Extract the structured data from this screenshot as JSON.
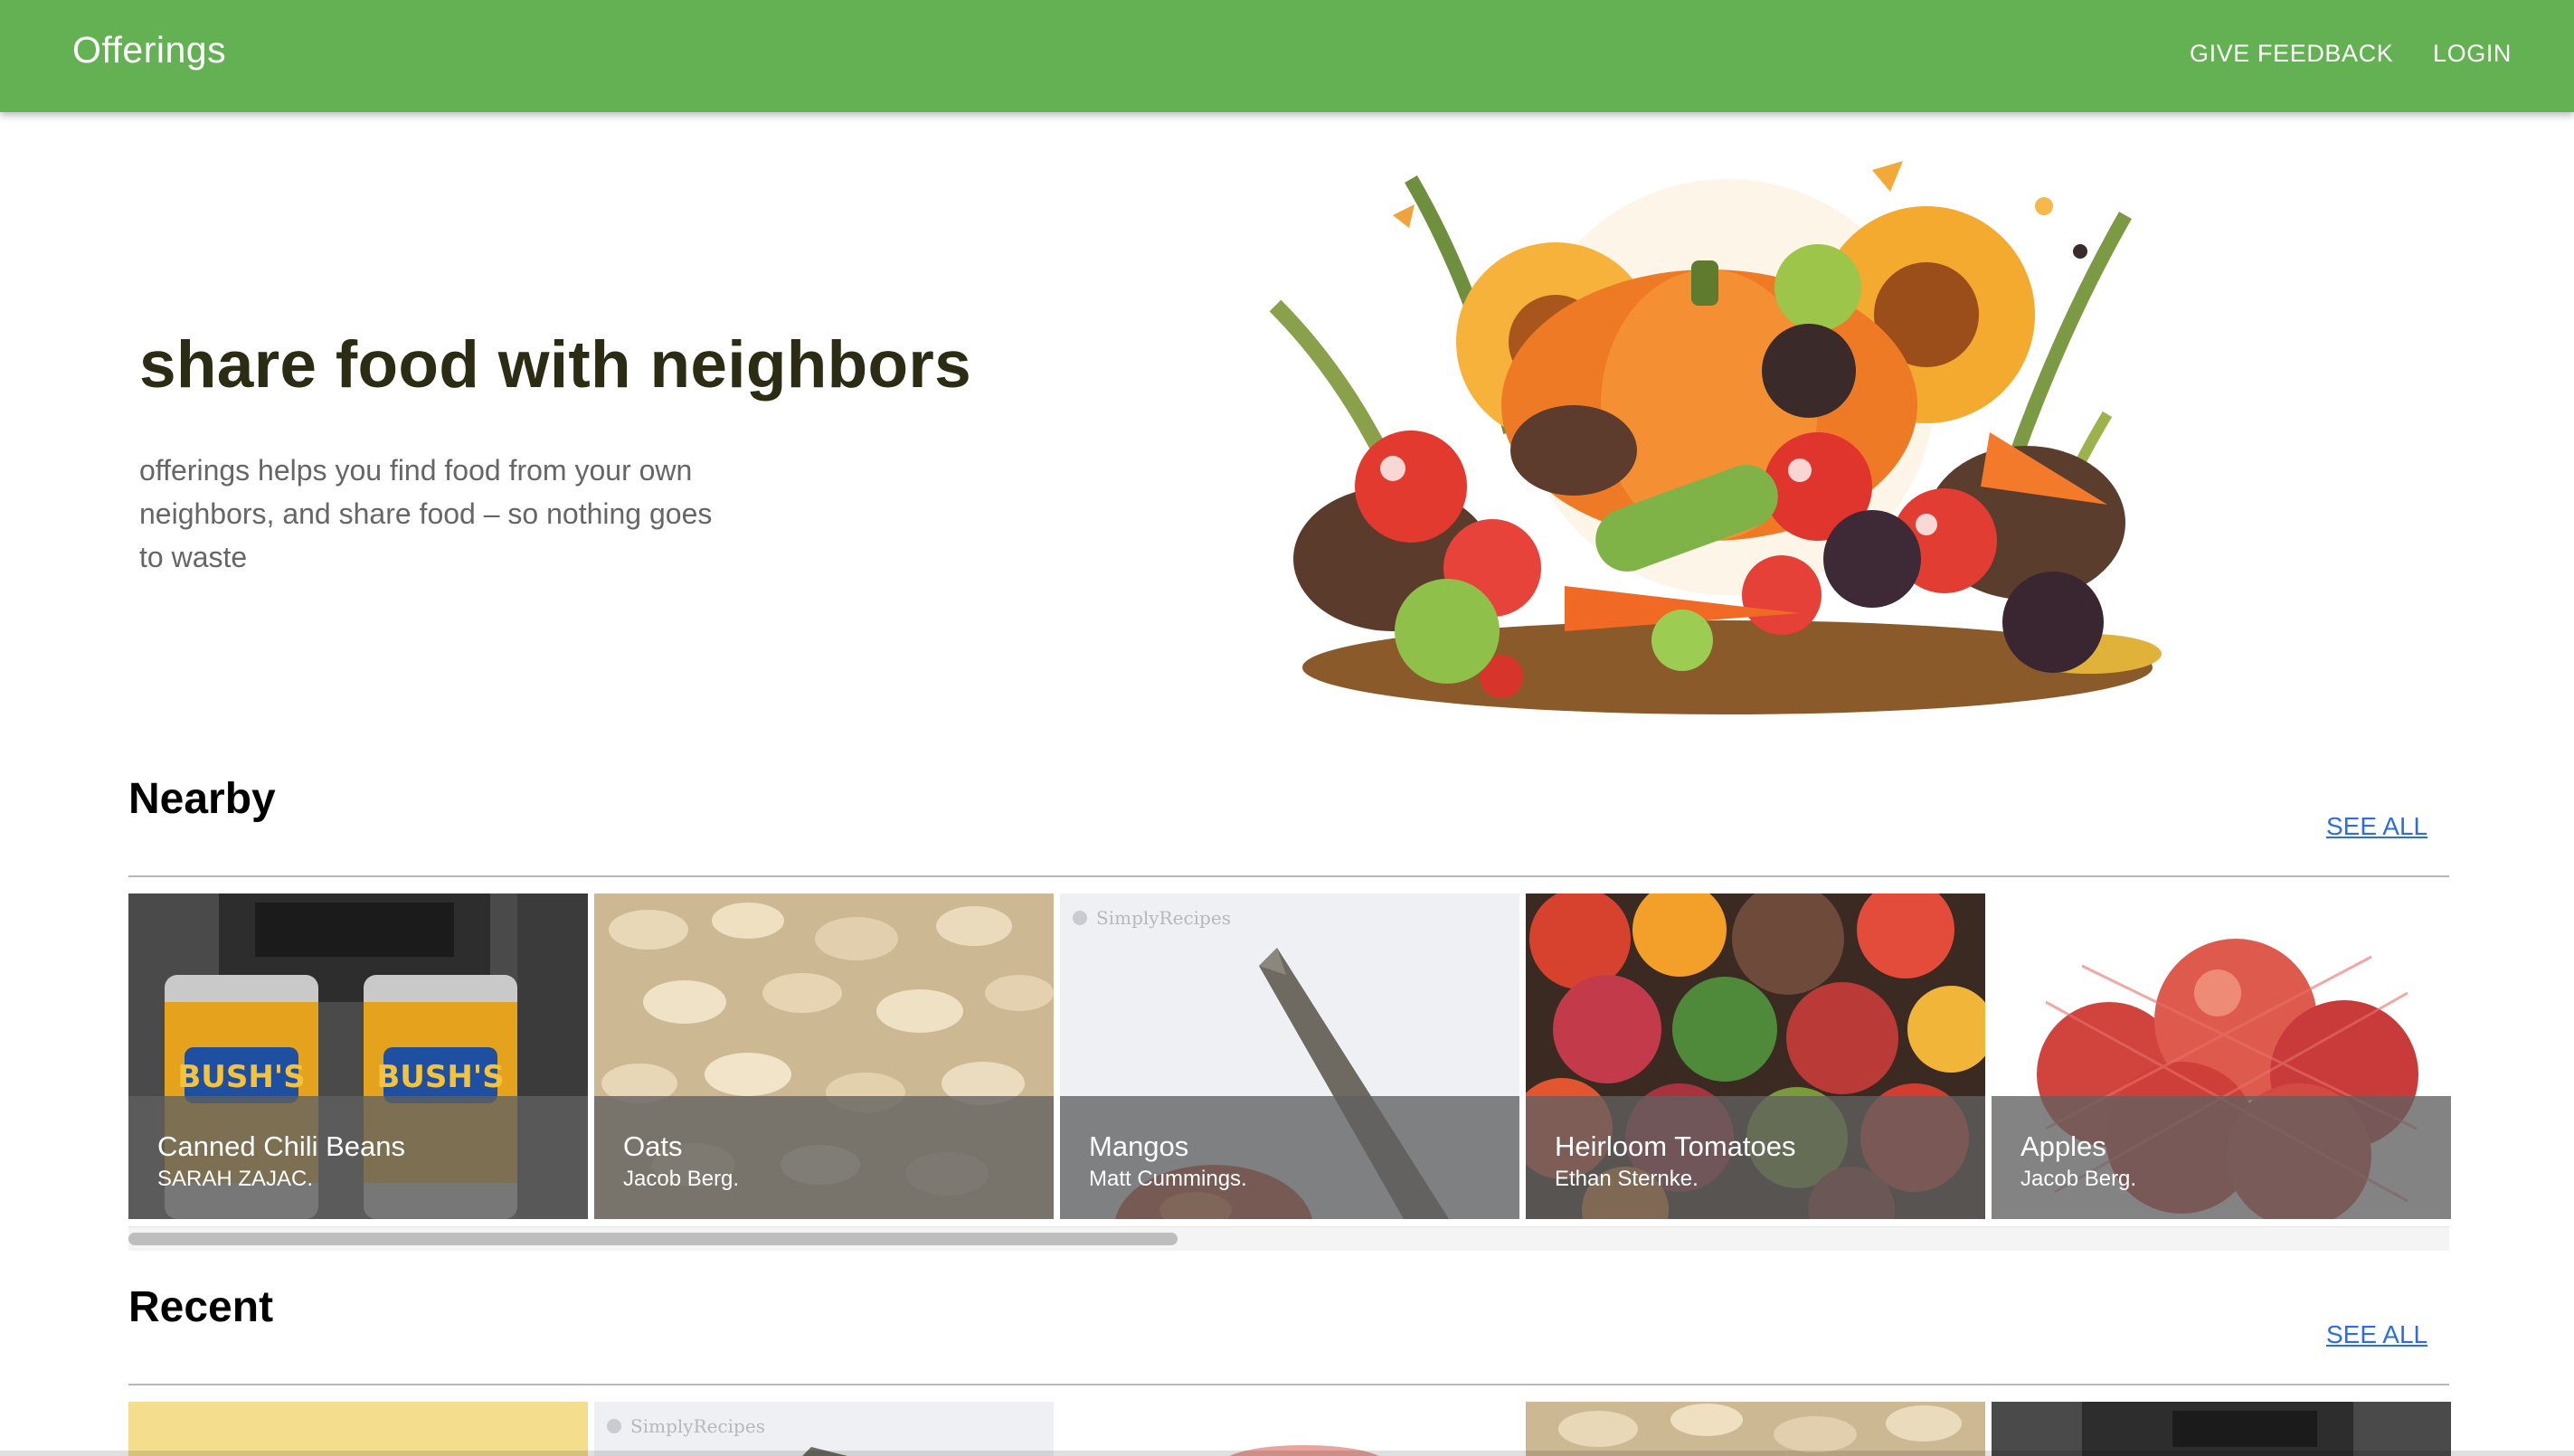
{
  "appbar": {
    "title": "Offerings",
    "feedback_label": "GIVE FEEDBACK",
    "login_label": "LOGIN"
  },
  "hero": {
    "title": "share food with neighbors",
    "description": "offerings helps you find food from your own neighbors, and share food – so nothing goes to waste"
  },
  "nearby": {
    "title": "Nearby",
    "see_all": "SEE ALL",
    "items": [
      {
        "title": "Canned Chili Beans",
        "owner": "SARAH ZAJAC.",
        "image": "canned-beans"
      },
      {
        "title": "Oats",
        "owner": "Jacob Berg.",
        "image": "oats"
      },
      {
        "title": "Mangos",
        "owner": "Matt Cummings.",
        "image": "mango",
        "watermark": "SimplyRecipes"
      },
      {
        "title": "Heirloom Tomatoes",
        "owner": "Ethan Sternke.",
        "image": "tomatoes"
      },
      {
        "title": "Apples",
        "owner": "Jacob Berg.",
        "image": "apples"
      }
    ]
  },
  "recent": {
    "title": "Recent",
    "see_all": "SEE ALL",
    "watermark": "SimplyRecipes"
  },
  "colors": {
    "appbar": "#64b153",
    "link": "#2d6de0",
    "hero_title": "#2c2b13"
  }
}
